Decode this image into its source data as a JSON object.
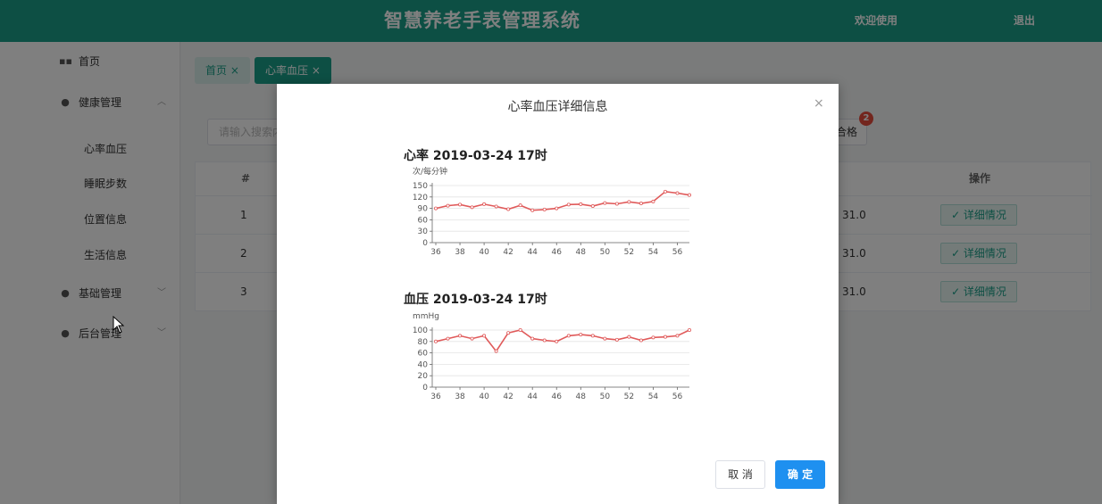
{
  "header": {
    "title": "智慧养老手表管理系统",
    "welcome": "欢迎使用",
    "logout": "退出"
  },
  "sidebar": {
    "items": [
      {
        "label": "首页",
        "icon": "grid-icon"
      },
      {
        "label": "健康管理",
        "icon": "location-pin-icon",
        "expanded": true
      },
      {
        "label": "基础管理",
        "icon": "location-pin-icon"
      },
      {
        "label": "后台管理",
        "icon": "location-pin-icon"
      }
    ],
    "health_sub": [
      "心率血压",
      "睡眠步数",
      "位置信息",
      "生活信息"
    ]
  },
  "tabs": [
    {
      "label": "首页 ×"
    },
    {
      "label": "心率血压 ×"
    }
  ],
  "search": {
    "placeholder": "请输入搜索内"
  },
  "pass_button": "合格",
  "badge": "2",
  "table": {
    "col_index": "#",
    "col_action": "操作",
    "rows": [
      {
        "index": "1",
        "value": "31.0",
        "action": "✓ 详细情况"
      },
      {
        "index": "2",
        "value": "31.0",
        "action": "✓ 详细情况"
      },
      {
        "index": "3",
        "value": "31.0",
        "action": "✓ 详细情况"
      }
    ]
  },
  "modal": {
    "title": "心率血压详细信息",
    "close": "×",
    "cancel": "取 消",
    "confirm": "确 定"
  },
  "colors": {
    "primary": "#1a9e88",
    "line": "#e05a5a",
    "confirm": "#1e90f0"
  },
  "chart_data": [
    {
      "type": "line",
      "title": "心率  2019-03-24 17时",
      "ylabel": "次/每分钟",
      "ylim": [
        0,
        150
      ],
      "yticks": [
        0,
        30,
        60,
        90,
        120,
        150
      ],
      "x_tick_labels": [
        "36",
        "38",
        "40",
        "42",
        "44",
        "46",
        "48",
        "50",
        "52",
        "54",
        "56"
      ],
      "x": [
        36,
        37,
        38,
        39,
        40,
        41,
        42,
        43,
        44,
        45,
        46,
        47,
        48,
        49,
        50,
        51,
        52,
        53,
        54,
        55,
        56,
        57
      ],
      "values": [
        90,
        97,
        100,
        93,
        101,
        95,
        88,
        98,
        85,
        87,
        90,
        100,
        101,
        96,
        104,
        102,
        107,
        103,
        108,
        134,
        130,
        125
      ]
    },
    {
      "type": "line",
      "title": "血压  2019-03-24 17时",
      "ylabel": "mmHg",
      "ylim": [
        0,
        100
      ],
      "yticks": [
        0,
        20,
        40,
        60,
        80,
        100
      ],
      "x_tick_labels": [
        "36",
        "38",
        "40",
        "42",
        "44",
        "46",
        "48",
        "50",
        "52",
        "54",
        "56"
      ],
      "x": [
        36,
        37,
        38,
        39,
        40,
        41,
        42,
        43,
        44,
        45,
        46,
        47,
        48,
        49,
        50,
        51,
        52,
        53,
        54,
        55,
        56,
        57
      ],
      "values": [
        80,
        85,
        90,
        85,
        90,
        63,
        95,
        100,
        85,
        82,
        80,
        90,
        92,
        90,
        85,
        83,
        88,
        82,
        87,
        88,
        90,
        100
      ]
    }
  ]
}
